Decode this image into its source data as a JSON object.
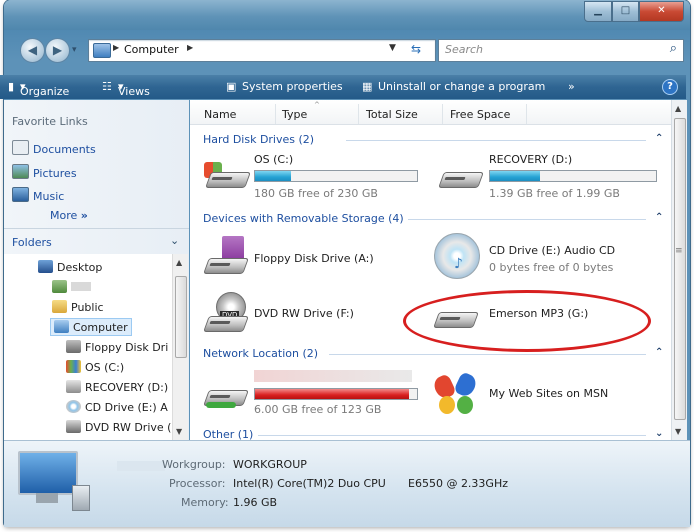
{
  "address": {
    "crumb_computer": "Computer",
    "search_placeholder": "Search"
  },
  "toolbar": {
    "organize": "Organize",
    "views": "Views",
    "system_properties": "System properties",
    "uninstall": "Uninstall or change a program",
    "more": "»"
  },
  "favorites": {
    "title": "Favorite Links",
    "items": [
      "Documents",
      "Pictures",
      "Music"
    ],
    "more": "More"
  },
  "folders": {
    "title": "Folders",
    "items": [
      "Desktop",
      "Public",
      "Computer",
      "Floppy Disk Dri",
      "OS (C:)",
      "RECOVERY (D:)",
      "CD Drive (E:) A",
      "DVD RW Drive ("
    ]
  },
  "columns": [
    "Name",
    "Type",
    "Total Size",
    "Free Space"
  ],
  "groups": {
    "hdd": "Hard Disk Drives (2)",
    "removable": "Devices with Removable Storage (4)",
    "network": "Network Location (2)",
    "other": "Other (1)"
  },
  "drives": {
    "c": {
      "name": "OS (C:)",
      "free": "180 GB free of 230 GB",
      "used_fraction": 0.22
    },
    "d": {
      "name": "RECOVERY (D:)",
      "free": "1.39 GB free of 1.99 GB",
      "used_fraction": 0.3
    },
    "a": {
      "name": "Floppy Disk Drive (A:)"
    },
    "e": {
      "name": "CD Drive (E:) Audio CD",
      "free": "0 bytes free of 0 bytes"
    },
    "f": {
      "name": "DVD RW Drive (F:)"
    },
    "g": {
      "name": "Emerson MP3  (G:)"
    },
    "net": {
      "free": "6.00 GB free of 123 GB",
      "used_fraction": 0.95
    },
    "msn": {
      "name": "My Web Sites on MSN"
    }
  },
  "details": {
    "workgroup_label": "Workgroup:",
    "workgroup": "WORKGROUP",
    "processor_label": "Processor:",
    "processor": "Intel(R) Core(TM)2 Duo CPU",
    "processor_model": "E6550  @ 2.33GHz",
    "memory_label": "Memory:",
    "memory": "1.96 GB"
  },
  "colors": {
    "accent": "#1e4fa0",
    "bar_fill": "#26a3d4",
    "bar_critical": "#d92020",
    "highlight_ellipse": "#d71f1f"
  }
}
